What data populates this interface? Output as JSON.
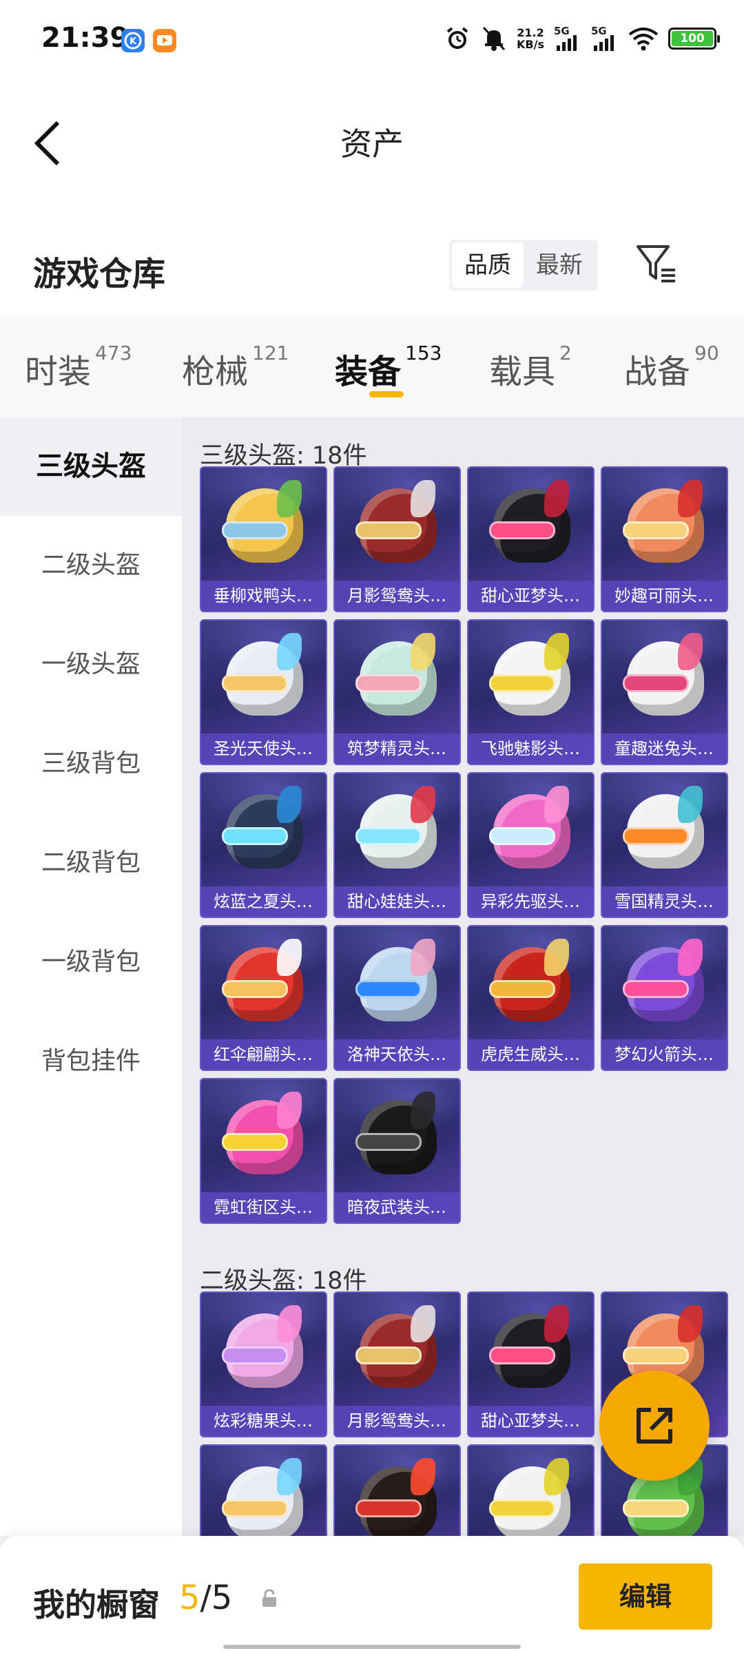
{
  "status": {
    "time": "21:39",
    "speed_value": "21.2",
    "speed_unit": "KB/s",
    "net1": "5G",
    "net2": "5G",
    "battery": "100"
  },
  "nav": {
    "title": "资产"
  },
  "warehouse": {
    "title": "游戏仓库",
    "sort_options": [
      "品质",
      "最新"
    ],
    "sort_active": "品质"
  },
  "tabs": [
    {
      "label": "时装",
      "count": "473"
    },
    {
      "label": "枪械",
      "count": "121"
    },
    {
      "label": "装备",
      "count": "153"
    },
    {
      "label": "载具",
      "count": "2"
    },
    {
      "label": "战备",
      "count": "90"
    }
  ],
  "active_tab": "装备",
  "sidebar": {
    "items": [
      "三级头盔",
      "二级头盔",
      "一级头盔",
      "三级背包",
      "二级背包",
      "一级背包",
      "背包挂件"
    ],
    "active": "三级头盔"
  },
  "sections": [
    {
      "title": "三级头盔: 18件",
      "items": [
        {
          "name": "垂柳戏鸭头…",
          "color": "#f3c64b",
          "accent": "#8ec8e6",
          "crest": "#6cc04a"
        },
        {
          "name": "月影鸳鸯头…",
          "color": "#9b2a2a",
          "accent": "#e7c26b",
          "crest": "#e8e0e0"
        },
        {
          "name": "甜心亚梦头…",
          "color": "#1e1e24",
          "accent": "#ff4f86",
          "crest": "#c21f3a"
        },
        {
          "name": "妙趣可丽头…",
          "color": "#f08a5d",
          "accent": "#f6d27c",
          "crest": "#d9302c"
        },
        {
          "name": "圣光天使头…",
          "color": "#e9ecf2",
          "accent": "#f6c766",
          "crest": "#77d6ff"
        },
        {
          "name": "筑梦精灵头…",
          "color": "#c7e8df",
          "accent": "#f3a7b4",
          "crest": "#f3d86a"
        },
        {
          "name": "飞驰魅影头…",
          "color": "#f4f4f4",
          "accent": "#f2d23a",
          "crest": "#e3d22a"
        },
        {
          "name": "童趣迷兔头…",
          "color": "#f2f2f2",
          "accent": "#e4477a",
          "crest": "#f05c8a"
        },
        {
          "name": "炫蓝之夏头…",
          "color": "#2c3b5e",
          "accent": "#6fe0ff",
          "crest": "#2b8ad6"
        },
        {
          "name": "甜心娃娃头…",
          "color": "#e8f0f0",
          "accent": "#86e6ff",
          "crest": "#e33a4a"
        },
        {
          "name": "异彩先驱头…",
          "color": "#ef6ac7",
          "accent": "#c9ecff",
          "crest": "#ff8fd4"
        },
        {
          "name": "雪国精灵头…",
          "color": "#f1f1f3",
          "accent": "#ff8a2c",
          "crest": "#41c2d2"
        },
        {
          "name": "红伞翩翩头…",
          "color": "#e2352d",
          "accent": "#f4c15a",
          "crest": "#ffffff"
        },
        {
          "name": "洛神天依头…",
          "color": "#bfd6ef",
          "accent": "#2b88ff",
          "crest": "#f0a6c6"
        },
        {
          "name": "虎虎生威头…",
          "color": "#c8261d",
          "accent": "#f2b53a",
          "crest": "#f4d36c"
        },
        {
          "name": "梦幻火箭头…",
          "color": "#7d4cd8",
          "accent": "#ff4f9a",
          "crest": "#ff66c9"
        },
        {
          "name": "霓虹街区头…",
          "color": "#f24fb0",
          "accent": "#f7d234",
          "crest": "#ff7fd1"
        },
        {
          "name": "暗夜武装头…",
          "color": "#1a1a1d",
          "accent": "#444",
          "crest": "#2a2a2e"
        }
      ]
    },
    {
      "title": "二级头盔: 18件",
      "items": [
        {
          "name": "炫彩糖果头…",
          "color": "#f0a8e6",
          "accent": "#c78bf2",
          "crest": "#ff8ed9"
        },
        {
          "name": "月影鸳鸯头…",
          "color": "#9b2a2a",
          "accent": "#e7c26b",
          "crest": "#e8e0e0"
        },
        {
          "name": "甜心亚梦头…",
          "color": "#1e1e24",
          "accent": "#ff4f86",
          "crest": "#c21f3a"
        },
        {
          "name": "",
          "color": "#f08a5d",
          "accent": "#f6d27c",
          "crest": "#d9302c"
        },
        {
          "name": "",
          "color": "#e9ecf2",
          "accent": "#f6c766",
          "crest": "#77d6ff"
        },
        {
          "name": "",
          "color": "#2a1b1b",
          "accent": "#d9342b",
          "crest": "#ff4a30"
        },
        {
          "name": "",
          "color": "#f2f2f2",
          "accent": "#f2d23a",
          "crest": "#e3d22a"
        },
        {
          "name": "",
          "color": "#5fc04a",
          "accent": "#f5d67a",
          "crest": "#3ea536"
        }
      ]
    }
  ],
  "bottom": {
    "label": "我的橱窗",
    "current": "5",
    "separator": "/",
    "total": "5",
    "edit": "编辑"
  },
  "colors": {
    "accent": "#f5b500",
    "card_bg": "#2c2a6a",
    "card_label": "#5a46be"
  }
}
